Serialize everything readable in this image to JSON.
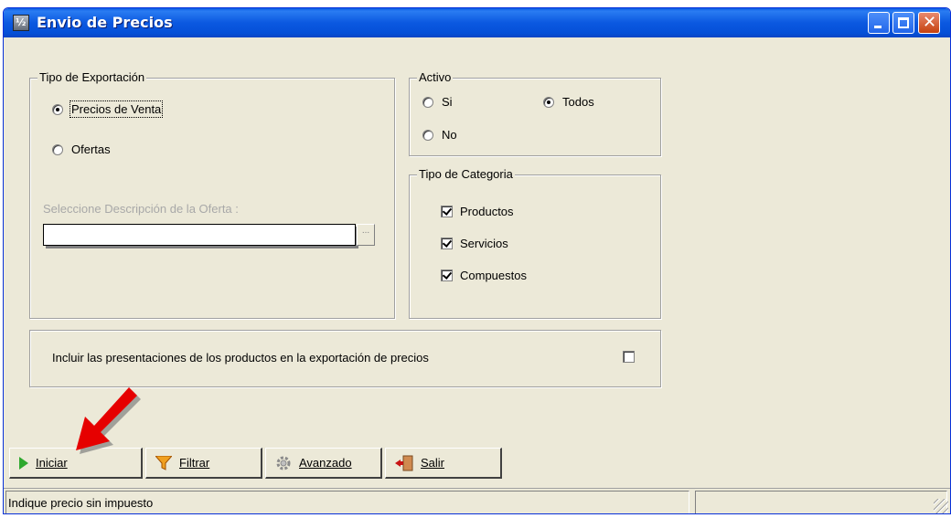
{
  "window": {
    "title": "Envio de Precios"
  },
  "tipo_exportacion": {
    "legend": "Tipo de Exportación",
    "options": [
      {
        "label": "Precios de Venta",
        "selected": true
      },
      {
        "label": "Ofertas",
        "selected": false
      }
    ],
    "oferta_label": "Seleccione Descripción de la Oferta :",
    "oferta_value": "",
    "browse_label": "..."
  },
  "activo": {
    "legend": "Activo",
    "options": [
      {
        "label": "Si",
        "selected": false
      },
      {
        "label": "Todos",
        "selected": true
      },
      {
        "label": "No",
        "selected": false
      }
    ]
  },
  "tipo_categoria": {
    "legend": "Tipo de Categoria",
    "items": [
      {
        "label": "Productos",
        "checked": true
      },
      {
        "label": "Servicios",
        "checked": true
      },
      {
        "label": "Compuestos",
        "checked": true
      }
    ]
  },
  "presentaciones": {
    "label": "Incluir las presentaciones de los productos en la exportación de precios",
    "checked": false
  },
  "buttons": {
    "iniciar": "Iniciar",
    "filtrar": "Filtrar",
    "avanzado": "Avanzado",
    "salir": "Salir"
  },
  "statusbar": {
    "message": "Indique precio sin impuesto",
    "secondary": ""
  },
  "colors": {
    "titlebar": "#0b58e0",
    "face": "#ece9d8",
    "arrow": "#e60000",
    "play": "#2ea82e",
    "exit": "#c81414"
  },
  "icons": [
    "play-icon",
    "funnel-icon",
    "gear-icon",
    "exit-door-icon",
    "red-arrow-icon"
  ]
}
